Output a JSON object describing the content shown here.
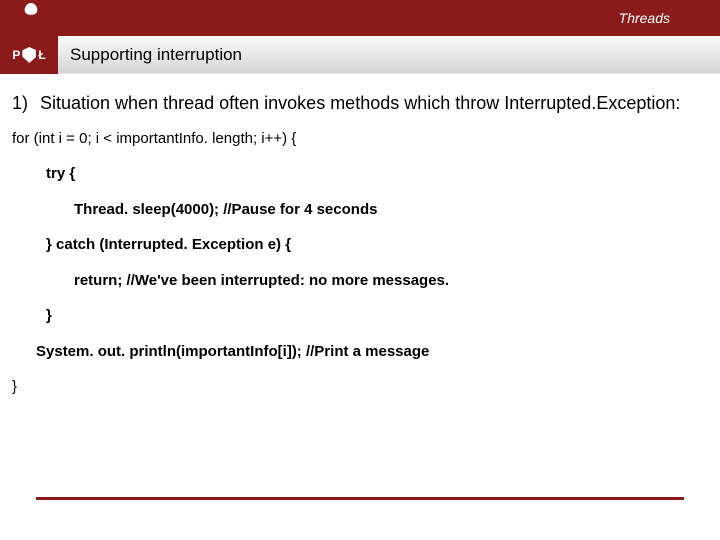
{
  "header": {
    "topic": "Threads",
    "subtitle": "Supporting interruption",
    "logo_left": "P",
    "logo_right": "Ł"
  },
  "list": {
    "marker": "1)",
    "text": "Situation when thread often invokes methods which throw Interrupted.Exception:"
  },
  "code": {
    "l0": "for (int i = 0; i < importantInfo. length; i++) {",
    "l1": "try {",
    "l2": "Thread. sleep(4000); //Pause for 4 seconds",
    "l3": "} catch (Interrupted. Exception e) {",
    "l4": "return; //We've been interrupted: no more messages.",
    "l5": "}",
    "l6": "System. out. println(importantInfo[i]); //Print a message",
    "l7": "}"
  }
}
